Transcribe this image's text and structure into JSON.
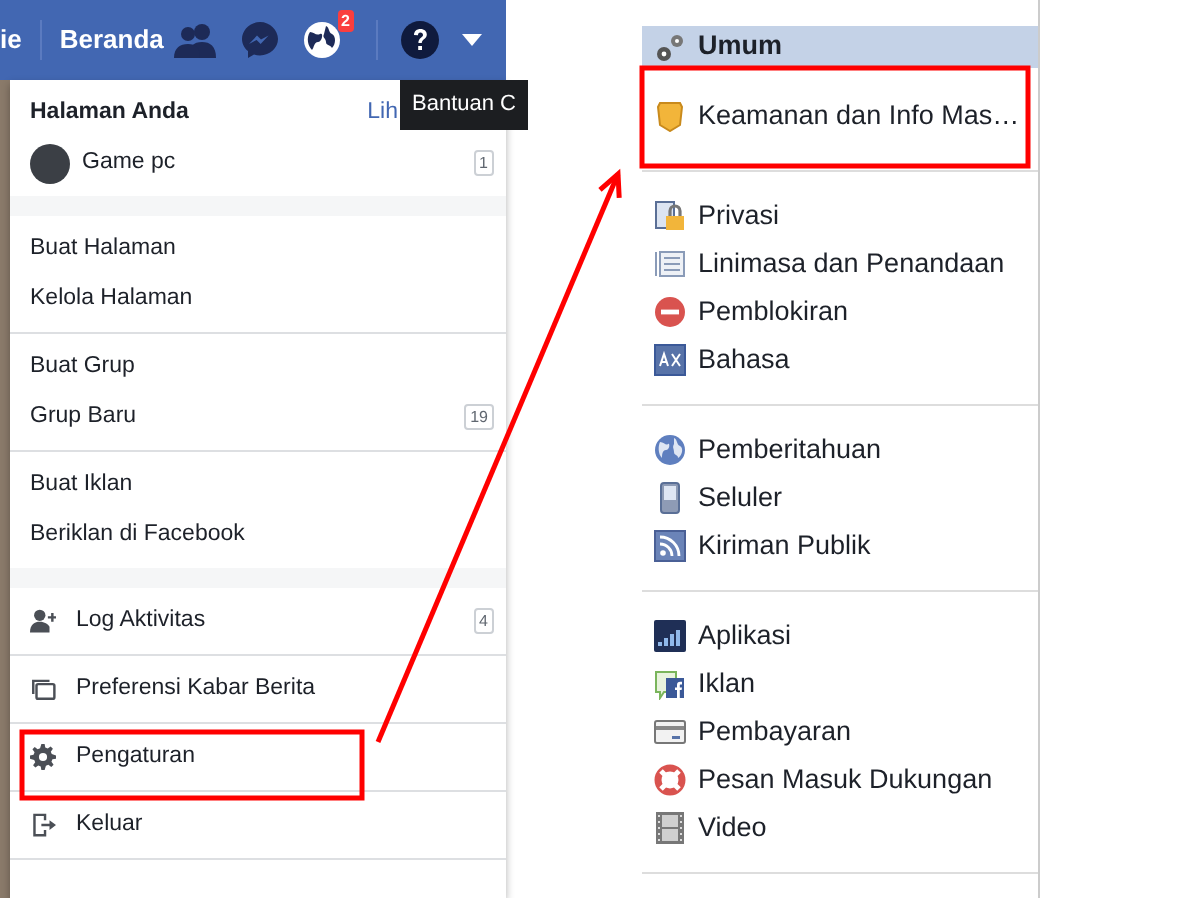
{
  "top_bar": {
    "cut_label": "ie",
    "home_link": "Beranda",
    "notification_count": "2",
    "tooltip": "Bantuan C"
  },
  "account_menu": {
    "sections": [
      {
        "header": "Halaman Anda",
        "header_link": "Lih",
        "items": [
          {
            "label": "Game pc",
            "count": "1",
            "kind": "page",
            "highlighted": false
          }
        ]
      },
      {
        "items": [
          {
            "label": "Buat Halaman",
            "kind": "plain",
            "highlighted": false
          },
          {
            "label": "Kelola Halaman",
            "kind": "plain",
            "highlighted": false
          }
        ]
      },
      {
        "items": [
          {
            "label": "Buat Grup",
            "kind": "plain",
            "highlighted": false
          },
          {
            "label": "Grup Baru",
            "count": "19",
            "kind": "plain",
            "highlighted": false
          }
        ]
      },
      {
        "items": [
          {
            "label": "Buat Iklan",
            "kind": "plain",
            "highlighted": false
          },
          {
            "label": "Beriklan di Facebook",
            "kind": "plain",
            "highlighted": false
          }
        ]
      },
      {
        "items": [
          {
            "label": "Log Aktivitas",
            "count": "4",
            "kind": "icon",
            "highlighted": false
          }
        ]
      },
      {
        "items": [
          {
            "label": "Preferensi Kabar Berita",
            "kind": "icon",
            "highlighted": false
          }
        ]
      },
      {
        "items": [
          {
            "label": "Pengaturan",
            "kind": "icon",
            "highlighted": true
          }
        ]
      },
      {
        "items": [
          {
            "label": "Keluar",
            "kind": "icon",
            "highlighted": false
          }
        ]
      }
    ]
  },
  "settings_sidebar": {
    "sections": [
      {
        "items": [
          {
            "label": "Umum",
            "selected": true,
            "highlighted": false
          },
          {
            "label": "Keamanan dan Info Mas…",
            "selected": false,
            "highlighted": true
          }
        ]
      },
      {
        "items": [
          {
            "label": "Privasi",
            "selected": false,
            "highlighted": false
          },
          {
            "label": "Linimasa dan Penandaan",
            "selected": false,
            "highlighted": false
          },
          {
            "label": "Pemblokiran",
            "selected": false,
            "highlighted": false
          },
          {
            "label": "Bahasa",
            "selected": false,
            "highlighted": false
          }
        ]
      },
      {
        "items": [
          {
            "label": "Pemberitahuan",
            "selected": false,
            "highlighted": false
          },
          {
            "label": "Seluler",
            "selected": false,
            "highlighted": false
          },
          {
            "label": "Kiriman Publik",
            "selected": false,
            "highlighted": false
          }
        ]
      },
      {
        "items": [
          {
            "label": "Aplikasi",
            "selected": false,
            "highlighted": false
          },
          {
            "label": "Iklan",
            "selected": false,
            "highlighted": false
          },
          {
            "label": "Pembayaran",
            "selected": false,
            "highlighted": false
          },
          {
            "label": "Pesan Masuk Dukungan",
            "selected": false,
            "highlighted": false
          },
          {
            "label": "Video",
            "selected": false,
            "highlighted": false
          }
        ]
      }
    ]
  }
}
